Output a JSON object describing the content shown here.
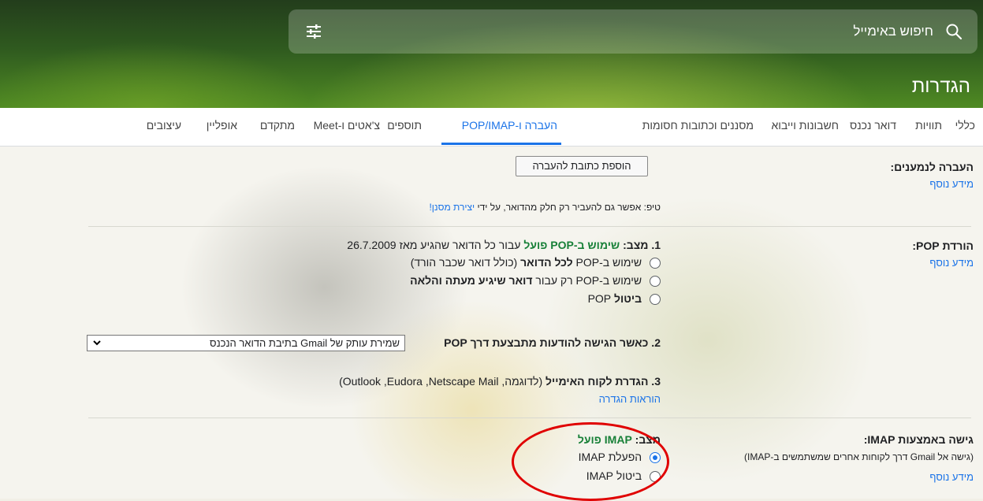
{
  "search": {
    "placeholder": "חיפוש באימייל",
    "icon": "search-icon",
    "filter_icon": "tune-icon"
  },
  "page": {
    "title": "הגדרות"
  },
  "tabs": [
    {
      "label": "כללי"
    },
    {
      "label": "תוויות"
    },
    {
      "label": "דואר נכנס"
    },
    {
      "label": "חשבונות וייבוא"
    },
    {
      "label": "מסננים וכתובות חסומות"
    },
    {
      "label": "העברה ו-POP/IMAP",
      "active": true
    },
    {
      "label": "תוספים"
    },
    {
      "label": "צ'אטים ו-Meet"
    },
    {
      "label": "מתקדם"
    },
    {
      "label": "אופליין"
    },
    {
      "label": "עיצובים"
    }
  ],
  "forwarding": {
    "label": "העברה לנמענים:",
    "learn_more": "מידע נוסף",
    "add_button": "הוספת כתובת להעברה",
    "tip_prefix": "טיפ: אפשר גם להעביר רק חלק מהדואר, על ידי",
    "tip_link": "יצירת מסנן!"
  },
  "pop": {
    "label": "הורדת POP:",
    "learn_more": "מידע נוסף",
    "status_prefix": "1. מצב:",
    "status_value": "שימוש ב-POP פועל",
    "status_suffix": "עבור כל הדואר שהגיע מאז 26.7.2009",
    "option1_pre": "שימוש ב-POP",
    "option1_bold": "לכל הדואר",
    "option1_post": "(כולל דואר שכבר הורד)",
    "option2_pre": "שימוש ב-POP רק עבור",
    "option2_bold": "דואר שיגיע מעתה והלאה",
    "option3_bold": "ביטול",
    "option3_post": "POP",
    "access_label": "2. כאשר הגישה להודעות מתבצעת דרך POP",
    "access_select": "שמירת עותק של Gmail בתיבת הדואר הנכנס",
    "client_bold": "3. הגדרת לקוח האימייל",
    "client_rest": "(לדוגמה, Outlook ,Eudora ,Netscape Mail)",
    "client_link": "הוראות הגדרה"
  },
  "imap": {
    "label": "גישה באמצעות IMAP:",
    "desc": "(גישה אל Gmail דרך לקוחות אחרים שמשתמשים ב-IMAP)",
    "learn_more": "מידע נוסף",
    "status_prefix": "מצב:",
    "status_value": "IMAP פועל",
    "enable_label": "הפעלת IMAP",
    "disable_label": "ביטול IMAP",
    "enabled": true
  },
  "colors": {
    "accent": "#1a73e8",
    "status_green": "#188038",
    "highlight_red": "#e00000"
  }
}
